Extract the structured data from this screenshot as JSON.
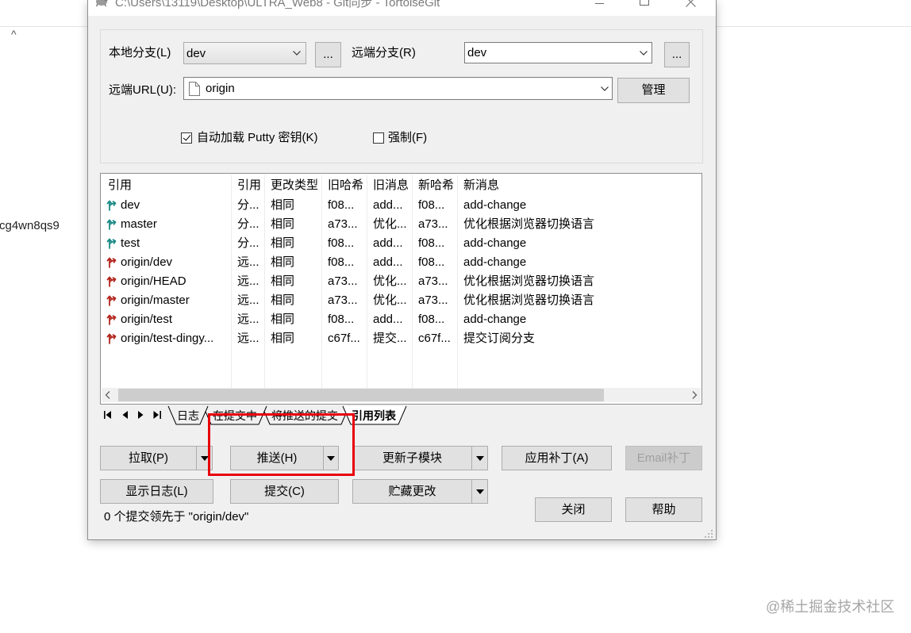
{
  "window": {
    "title": "C:\\Users\\13119\\Desktop\\ULTRA_Web8 - Git同步 - TortoiseGit",
    "icon": "tortoisegit-app-icon",
    "controls": [
      "minimize-icon",
      "maximize-icon",
      "close-icon"
    ]
  },
  "page": {
    "caret": "^",
    "side_text": "cg4wn8qs9",
    "watermark": "@稀土掘金技术社区"
  },
  "branches": {
    "local_label": "本地分支(L)",
    "local_value": "dev",
    "local_browse_label": "...",
    "remote_label": "远端分支(R)",
    "remote_value": "dev",
    "remote_browse_label": "...",
    "url_label": "远端URL(U):",
    "url_value": "origin",
    "url_icon": "file-icon",
    "manage_label": "管理"
  },
  "options": {
    "autoload_putty_label": "自动加载 Putty 密钥(K)",
    "autoload_putty_checked": true,
    "force_label": "强制(F)",
    "force_checked": false
  },
  "refs_table": {
    "columns": [
      "引用",
      "引用",
      "更改类型",
      "旧哈希",
      "旧消息",
      "新哈希",
      "新消息"
    ],
    "rows": [
      {
        "icon": "local-branch-icon",
        "ref": "dev",
        "ref_type": "分...",
        "change": "相同",
        "old_hash": "f08...",
        "old_msg": "add...",
        "new_hash": "f08...",
        "new_msg": "add-change"
      },
      {
        "icon": "local-branch-icon",
        "ref": "master",
        "ref_type": "分...",
        "change": "相同",
        "old_hash": "a73...",
        "old_msg": "优化...",
        "new_hash": "a73...",
        "new_msg": "优化根据浏览器切换语言"
      },
      {
        "icon": "local-branch-icon",
        "ref": "test",
        "ref_type": "分...",
        "change": "相同",
        "old_hash": "f08...",
        "old_msg": "add...",
        "new_hash": "f08...",
        "new_msg": "add-change"
      },
      {
        "icon": "remote-branch-icon",
        "ref": "origin/dev",
        "ref_type": "远...",
        "change": "相同",
        "old_hash": "f08...",
        "old_msg": "add...",
        "new_hash": "f08...",
        "new_msg": "add-change"
      },
      {
        "icon": "remote-branch-icon",
        "ref": "origin/HEAD",
        "ref_type": "远...",
        "change": "相同",
        "old_hash": "a73...",
        "old_msg": "优化...",
        "new_hash": "a73...",
        "new_msg": "优化根据浏览器切换语言"
      },
      {
        "icon": "remote-branch-icon",
        "ref": "origin/master",
        "ref_type": "远...",
        "change": "相同",
        "old_hash": "a73...",
        "old_msg": "优化...",
        "new_hash": "a73...",
        "new_msg": "优化根据浏览器切换语言"
      },
      {
        "icon": "remote-branch-icon",
        "ref": "origin/test",
        "ref_type": "远...",
        "change": "相同",
        "old_hash": "f08...",
        "old_msg": "add...",
        "new_hash": "f08...",
        "new_msg": "add-change"
      },
      {
        "icon": "remote-branch-icon",
        "ref": "origin/test-dingy...",
        "ref_type": "远...",
        "change": "相同",
        "old_hash": "c67f...",
        "old_msg": "提交...",
        "new_hash": "c67f...",
        "new_msg": "提交订阅分支"
      }
    ],
    "scroll_icons": [
      "scroll-left-icon",
      "scroll-right-icon"
    ]
  },
  "tabs": {
    "nav_icons": [
      "first-tab-icon",
      "prev-tab-icon",
      "next-tab-icon",
      "last-tab-icon"
    ],
    "items": [
      {
        "label": "日志",
        "active": false
      },
      {
        "label": "在提交中",
        "active": false
      },
      {
        "label": "将推送的提交",
        "active": false
      },
      {
        "label": "引用列表",
        "active": true
      }
    ]
  },
  "actions": {
    "pull": "拉取(P)",
    "push": "推送(H)",
    "update_submodules": "更新子模块",
    "apply_patch": "应用补丁(A)",
    "email_patch": "Email补丁",
    "email_patch_enabled": false,
    "show_log": "显示日志(L)",
    "commit": "提交(C)",
    "stash": "贮藏更改",
    "close": "关闭",
    "help": "帮助",
    "dropdown_icon": "dropdown-arrow-icon"
  },
  "status_text": "0 个提交领先于 \"origin/dev\"",
  "colors": {
    "local_ref_icon": "#1b8a86",
    "remote_ref_icon": "#b3261e",
    "highlight_box": "#e8000b",
    "window_body": "#f0f0f0",
    "disabled_text": "#a0a0a0"
  }
}
